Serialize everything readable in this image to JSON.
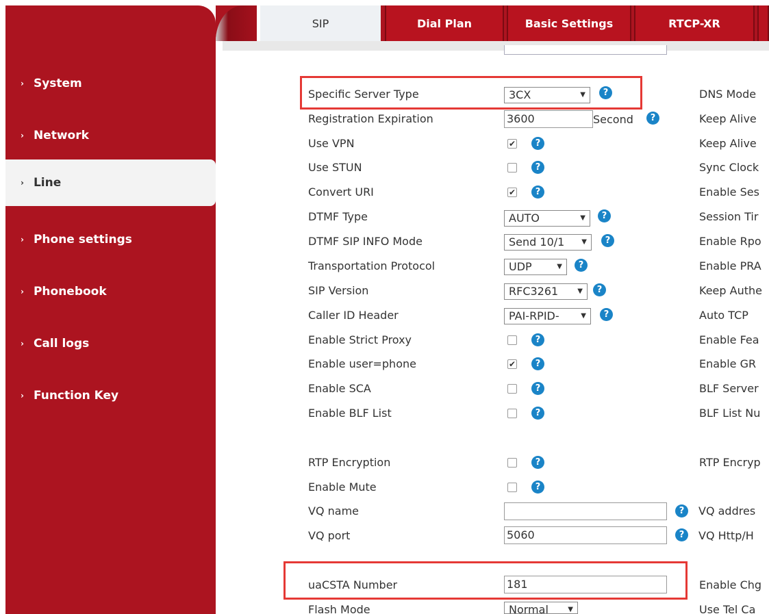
{
  "sidebar": {
    "items": [
      {
        "label": "System"
      },
      {
        "label": "Network"
      },
      {
        "label": "Line"
      },
      {
        "label": "Phone settings"
      },
      {
        "label": "Phonebook"
      },
      {
        "label": "Call logs"
      },
      {
        "label": "Function Key"
      }
    ],
    "active": "Line",
    "chevron": "›"
  },
  "tabs": [
    {
      "label": "SIP"
    },
    {
      "label": "Dial Plan"
    },
    {
      "label": "Basic Settings"
    },
    {
      "label": "RTCP-XR"
    }
  ],
  "form": {
    "specific_server_type": {
      "label": "Specific Server Type",
      "value": "3CX"
    },
    "registration_expiration": {
      "label": "Registration Expiration",
      "value": "3600",
      "unit": "Second"
    },
    "use_vpn": {
      "label": "Use VPN",
      "checked": true
    },
    "use_stun": {
      "label": "Use STUN",
      "checked": false
    },
    "convert_uri": {
      "label": "Convert URI",
      "checked": true
    },
    "dtmf_type": {
      "label": "DTMF Type",
      "value": "AUTO"
    },
    "dtmf_sip_info_mode": {
      "label": "DTMF SIP INFO Mode",
      "value": "Send 10/1"
    },
    "transportation_protocol": {
      "label": "Transportation Protocol",
      "value": "UDP"
    },
    "sip_version": {
      "label": "SIP Version",
      "value": "RFC3261"
    },
    "caller_id_header": {
      "label": "Caller ID Header",
      "value": "PAI-RPID-"
    },
    "enable_strict_proxy": {
      "label": "Enable Strict Proxy",
      "checked": false
    },
    "enable_user_phone": {
      "label": "Enable user=phone",
      "checked": true
    },
    "enable_sca": {
      "label": "Enable SCA",
      "checked": false
    },
    "enable_blf_list": {
      "label": "Enable BLF List",
      "checked": false
    },
    "rtp_encryption": {
      "label": "RTP Encryption",
      "checked": false
    },
    "enable_mute": {
      "label": "Enable Mute",
      "checked": false
    },
    "vq_name": {
      "label": "VQ name",
      "value": ""
    },
    "vq_port": {
      "label": "VQ port",
      "value": "5060"
    },
    "uacsta_number": {
      "label": "uaCSTA Number",
      "value": "181"
    },
    "flash_mode": {
      "label": "Flash Mode",
      "value": "Normal"
    }
  },
  "right_labels": [
    "DNS Mode",
    "Keep Alive",
    "Keep Alive",
    "Sync Clock",
    "Enable Ses",
    "Session Tir",
    "Enable Rpo",
    "Enable PRA",
    "Keep Authe",
    "Auto TCP",
    "Enable Fea",
    "Enable GR",
    "BLF Server",
    "BLF List Nu",
    "RTP Encryp",
    "VQ addres",
    "VQ Http/H",
    "Enable Chg",
    "Use Tel Ca"
  ],
  "icons": {
    "help": "?",
    "check": "✔",
    "dropdown": "▼"
  },
  "colors": {
    "sidebar": "#ac1420",
    "help": "#1a84c7",
    "highlight": "#e53935"
  }
}
